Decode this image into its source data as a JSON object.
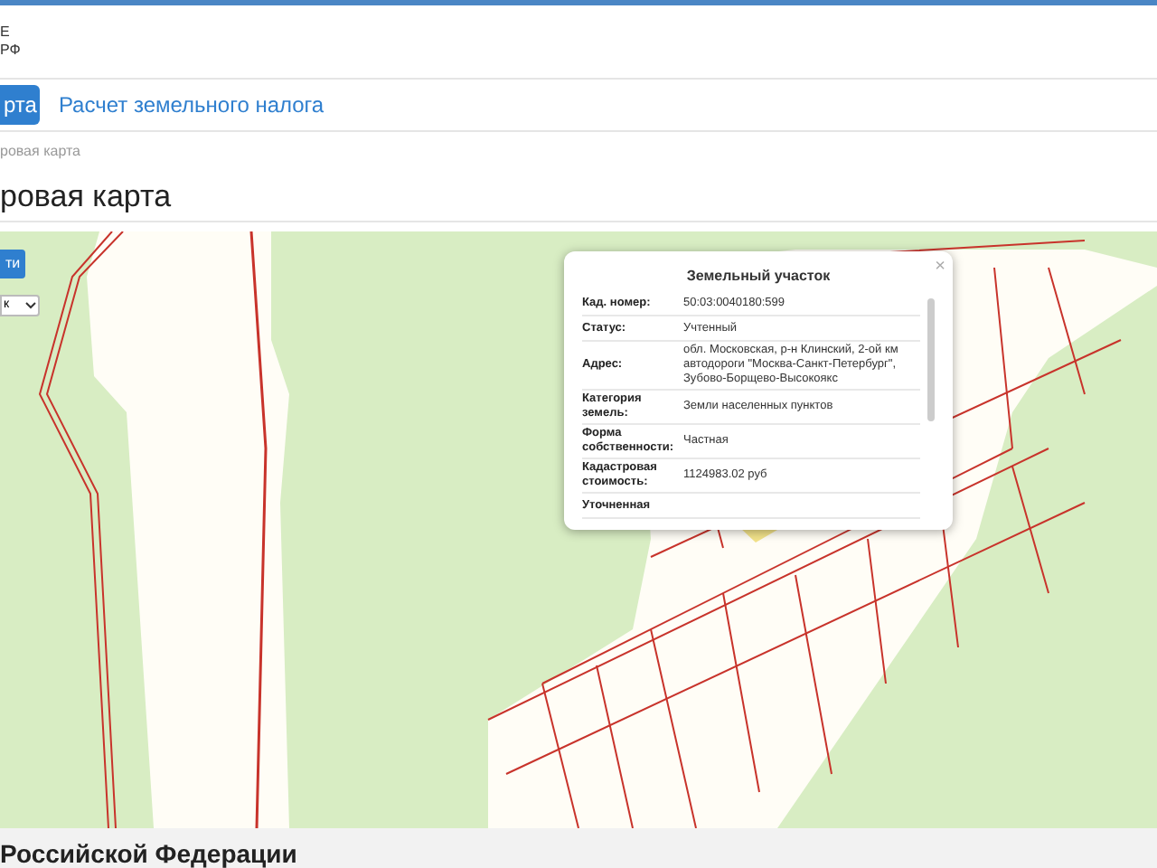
{
  "header": {
    "logo_lines": [
      "Е",
      "РФ"
    ]
  },
  "nav": [
    {
      "label": "рта",
      "selected": true
    },
    {
      "label": "Расчет земельного налога",
      "selected": false
    }
  ],
  "breadcrumb": "ровая карта",
  "title": "ровая карта",
  "map": {
    "button": "ти",
    "select": "к",
    "popup": {
      "title": "Земельный участок",
      "close": "×",
      "rows": [
        {
          "label": "Кад. номер:",
          "value": "50:03:0040180:599"
        },
        {
          "label": "Статус:",
          "value": "Учтенный"
        },
        {
          "label": "Адрес:",
          "value": "обл. Московская, р-н Клинский, 2-ой км автодороги \"Москва-Санкт-Петербург\", Зубово-Борщево-Высокоякс"
        },
        {
          "label": "Категория земель:",
          "value": "Земли населенных пунктов"
        },
        {
          "label": "Форма собственности:",
          "value": "Частная"
        },
        {
          "label": "Кадастровая стоимость:",
          "value": "1124983.02 руб"
        },
        {
          "label": "Уточненная",
          "value": ""
        }
      ]
    }
  },
  "footer": "Российской Федерации"
}
